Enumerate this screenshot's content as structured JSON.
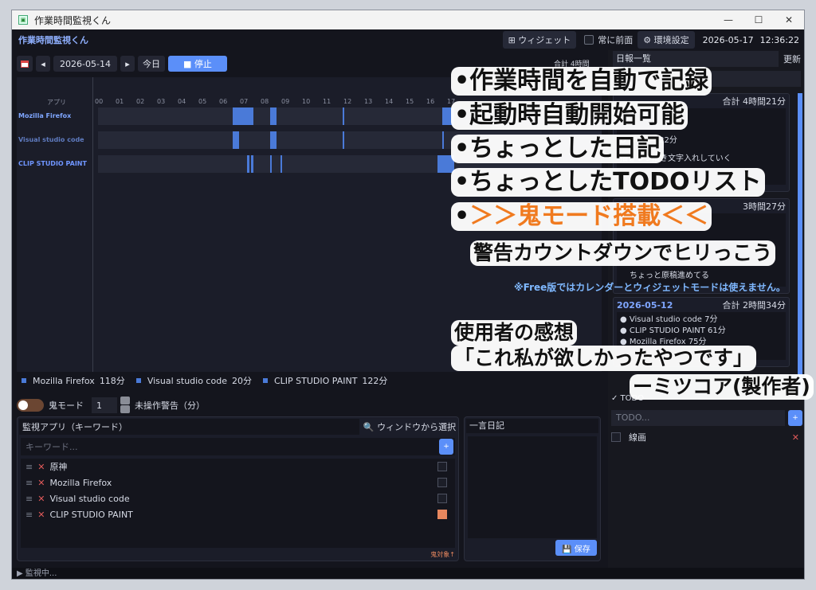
{
  "window": {
    "title": "作業時間監視くん",
    "minimize": "—",
    "maximize": "☐",
    "close": "✕"
  },
  "topbar": {
    "brand": "作業時間監視くん",
    "widget_label": "⊞ ウィジェット",
    "always_front_label": "常に前面",
    "settings_label": "⚙ 環境設定",
    "date": "2026-05-17",
    "time": "12:36:22"
  },
  "datebar": {
    "prev": "◂",
    "date": "2026-05-14",
    "next": "▸",
    "today": "今日",
    "stop": "■ 停止",
    "total_partial": "合計 4時間"
  },
  "timeline": {
    "app_header": "アプリ",
    "hours": [
      "00",
      "01",
      "02",
      "03",
      "04",
      "05",
      "06",
      "07",
      "08",
      "09",
      "10",
      "11",
      "12",
      "13",
      "14",
      "15",
      "16",
      "17"
    ],
    "apps": [
      {
        "name": "Mozilla Firefox",
        "color": "#7fa6ff",
        "blocks": [
          [
            6.5,
            7.5
          ],
          [
            8.3,
            8.6
          ],
          [
            11.8,
            11.9
          ],
          [
            16.6,
            17.2
          ]
        ]
      },
      {
        "name": "Visual studio code",
        "color": "#5f7bbf",
        "blocks": [
          [
            6.5,
            6.8
          ],
          [
            8.3,
            8.6
          ],
          [
            11.8,
            11.9
          ],
          [
            16.6,
            16.7
          ]
        ]
      },
      {
        "name": "CLIP STUDIO PAINT",
        "color": "#6f95ff",
        "blocks": [
          [
            7.2,
            7.3
          ],
          [
            7.4,
            7.5
          ],
          [
            8.3,
            8.4
          ],
          [
            8.8,
            8.9
          ],
          [
            16.4,
            17.2
          ]
        ]
      }
    ]
  },
  "legend": [
    {
      "name": "Mozilla Firefox",
      "value": "118分"
    },
    {
      "name": "Visual studio code",
      "value": "20分"
    },
    {
      "name": "CLIP STUDIO PAINT",
      "value": "122分"
    }
  ],
  "oni": {
    "label": "鬼モード",
    "minutes": "1",
    "idle_label": "未操作警告（分）"
  },
  "monitor": {
    "header": "監視アプリ（キーワード）",
    "select_window": "🔍 ウィンドウから選択",
    "keyword_placeholder": "キーワード...",
    "add": "+",
    "items": [
      {
        "name": "原神",
        "oni": false
      },
      {
        "name": "Mozilla Firefox",
        "oni": false
      },
      {
        "name": "Visual studio code",
        "oni": false
      },
      {
        "name": "CLIP STUDIO PAINT",
        "oni": true
      }
    ],
    "oni_target": "鬼対象↑"
  },
  "diary": {
    "header": "一言日記",
    "save": "💾 保存"
  },
  "status": "▶ 監視中...",
  "history": {
    "label": "日報一覧",
    "refresh": "更新",
    "cards": [
      {
        "date": "",
        "total": "合計 4時間21分",
        "lines": [
          "D PAINT 122分",
          "描きつつ描き文字入れしていく"
        ]
      },
      {
        "date": "",
        "total": "3時間27分",
        "lines": [
          "ちょっと原稿進めてる"
        ]
      },
      {
        "date": "2026-05-12",
        "total": "合計 2時間34分",
        "lines": [
          "● Visual studio code 7分",
          "● CLIP STUDIO PAINT 61分",
          "● Mozilla Firefox 75分"
        ]
      }
    ]
  },
  "todo": {
    "header": "✓ TODO",
    "placeholder": "TODO...",
    "add": "+",
    "items": [
      {
        "name": "線画",
        "delete": "✕"
      }
    ]
  },
  "overlay": {
    "f1": "•作業時間を自動で記録",
    "f2": "•起動時自動開始可能",
    "f3": "•ちょっとした日記",
    "f4": "•ちょっとしたTODOリスト",
    "f5_bullet": "•",
    "f5": "＞＞鬼モード搭載＜＜",
    "f6": "警告カウントダウンでヒリっこう",
    "free_note": "※Free版ではカレンダーとウィジェットモードは使えません。",
    "impression_title": "使用者の感想",
    "impression_quote": "「これ私が欲しかったやつです」",
    "impression_author": "ーミツコア(製作者)"
  }
}
